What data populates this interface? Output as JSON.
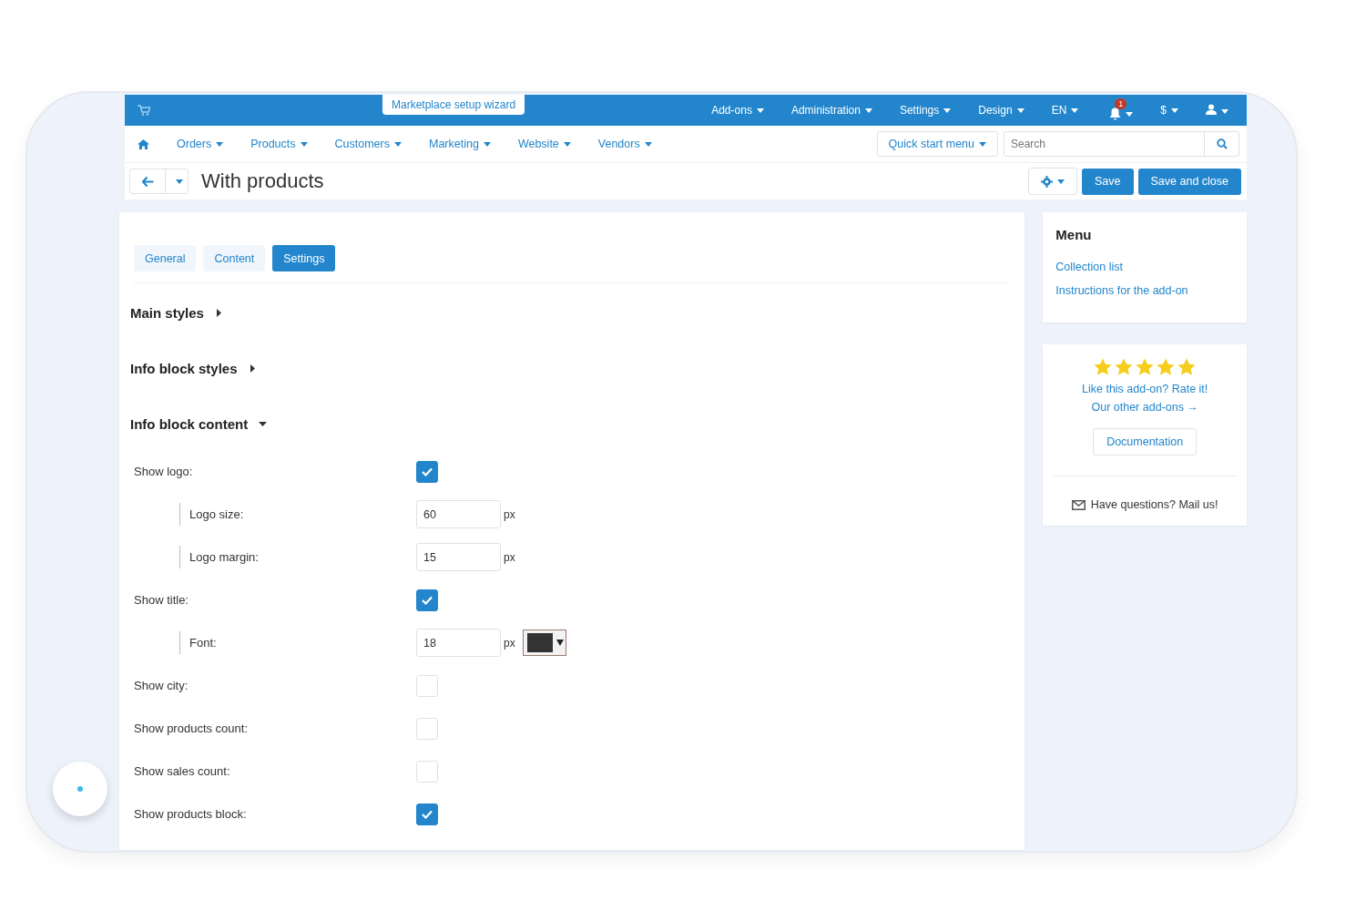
{
  "top_bar": {
    "wizard": "Marketplace setup wizard",
    "menus": [
      "Add-ons",
      "Administration",
      "Settings",
      "Design",
      "EN"
    ],
    "notifications": "1",
    "currency": "$"
  },
  "nav": {
    "items": [
      "Orders",
      "Products",
      "Customers",
      "Marketing",
      "Website",
      "Vendors"
    ],
    "quick_start": "Quick start menu",
    "search": {
      "placeholder": "Search"
    }
  },
  "header": {
    "title": "With products",
    "buttons": [
      "Save",
      "Save and close"
    ]
  },
  "tabs": [
    {
      "label": "General",
      "selected": false
    },
    {
      "label": "Content",
      "selected": false
    },
    {
      "label": "Settings",
      "selected": true
    }
  ],
  "sections": [
    {
      "title": "Main styles",
      "expanded": false
    },
    {
      "title": "Info block styles",
      "expanded": false
    },
    {
      "title": "Info block content",
      "expanded": true,
      "fields": [
        {
          "kind": "checkbox",
          "label": "Show logo:",
          "checked": true,
          "children": [
            {
              "kind": "number",
              "label": "Logo size:",
              "value": "60",
              "unit": "px"
            },
            {
              "kind": "number",
              "label": "Logo margin:",
              "value": "15",
              "unit": "px"
            }
          ]
        },
        {
          "kind": "checkbox",
          "label": "Show title:",
          "checked": true,
          "children": [
            {
              "kind": "font",
              "label": "Font:",
              "value": "18",
              "unit": "px",
              "color": "#333333"
            }
          ]
        },
        {
          "kind": "checkbox",
          "label": "Show city:",
          "checked": false
        },
        {
          "kind": "checkbox",
          "label": "Show products count:",
          "checked": false
        },
        {
          "kind": "checkbox",
          "label": "Show sales count:",
          "checked": false
        },
        {
          "kind": "checkbox",
          "label": "Show products block:",
          "checked": true
        }
      ]
    }
  ],
  "sidebar": {
    "title": "Menu",
    "links": [
      "Collection list",
      "Instructions for the add-on"
    ]
  },
  "rating": {
    "stars": 5,
    "rate_text": "Like this add-on? Rate it!",
    "other": "Our other add-ons →",
    "documentation": "Documentation",
    "mail": "Have questions? Mail us!"
  }
}
